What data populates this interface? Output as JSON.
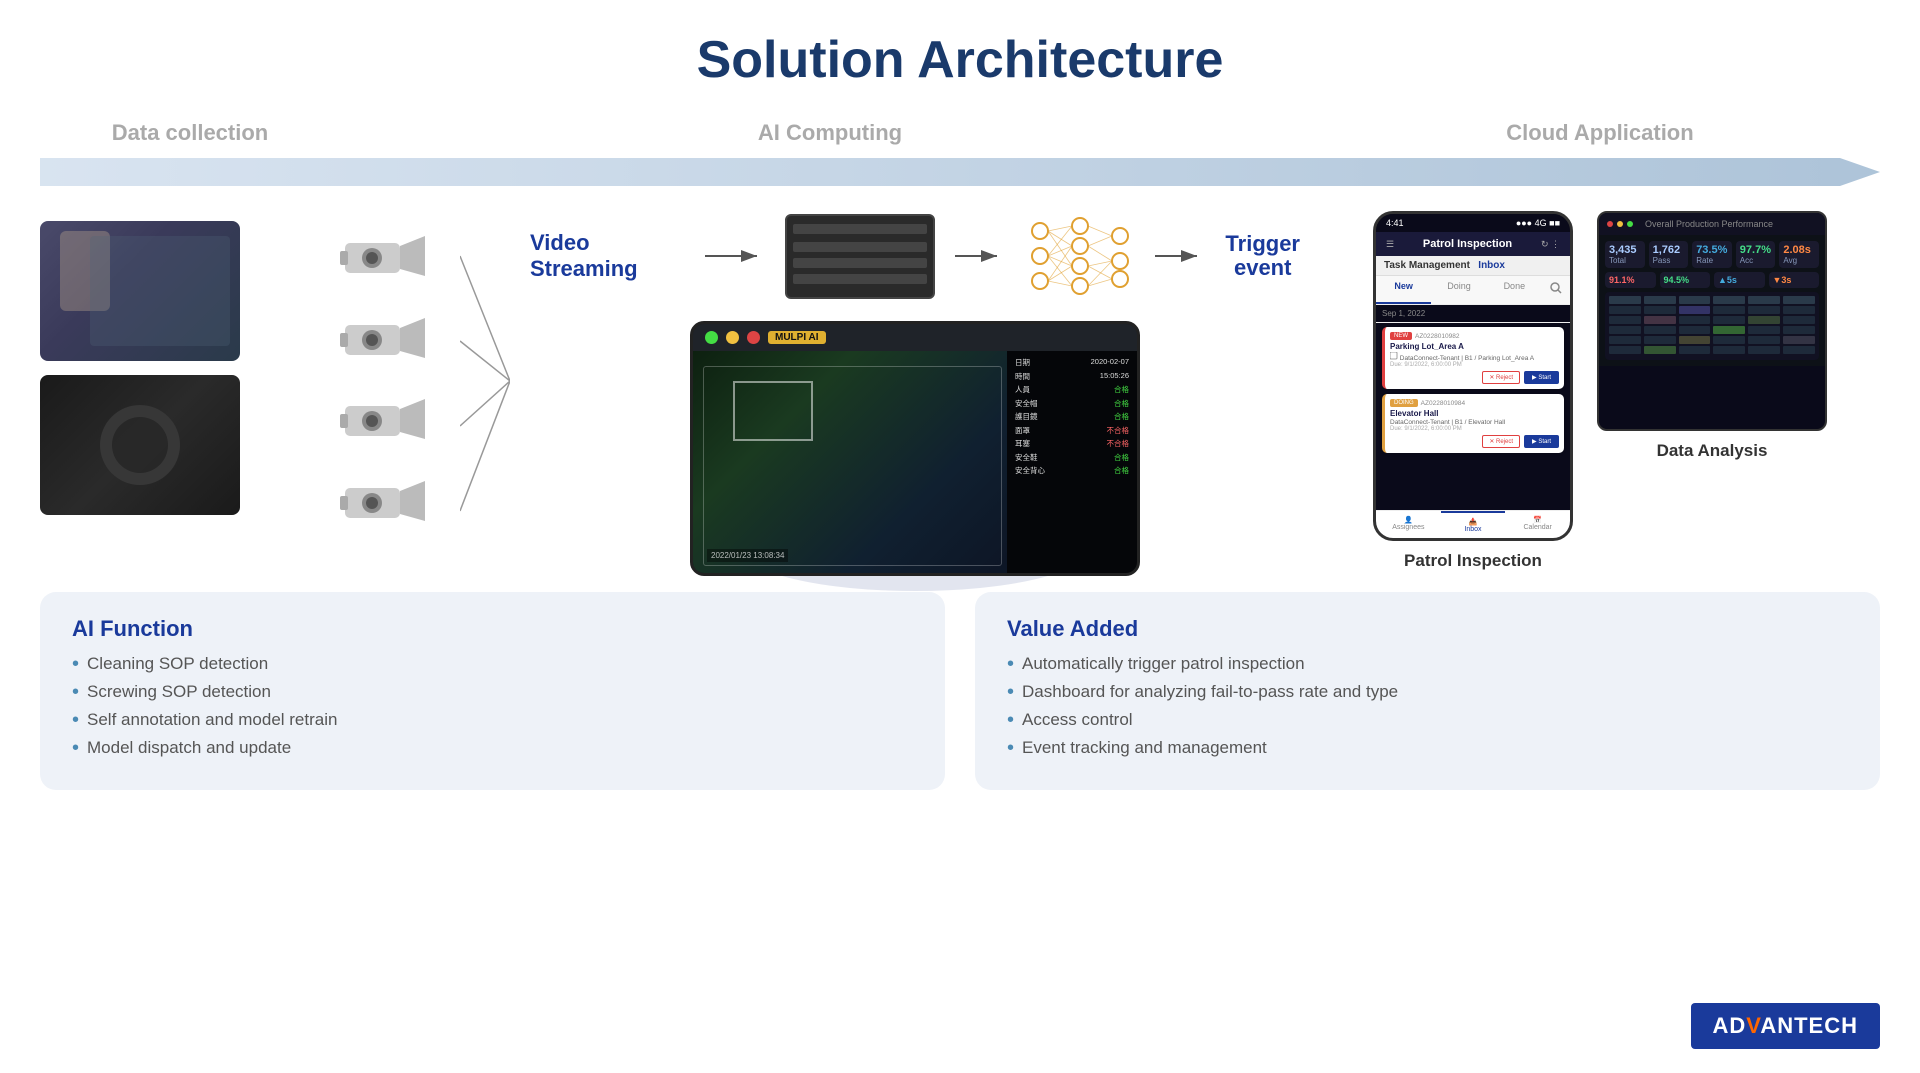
{
  "title": "Solution Architecture",
  "sections": {
    "data_collection": "Data collection",
    "ai_computing": "AI Computing",
    "cloud_application": "Cloud Application"
  },
  "labels": {
    "video_streaming": "Video Streaming",
    "trigger_event": "Trigger\nevent",
    "patrol_inspection": "Patrol Inspection",
    "data_analysis": "Data Analysis"
  },
  "ai_function": {
    "title": "AI Function",
    "items": [
      "Cleaning SOP detection",
      "Screwing SOP detection",
      "Self annotation and  model retrain",
      "Model dispatch and update"
    ]
  },
  "value_added": {
    "title": "Value Added",
    "items": [
      "Automatically trigger patrol inspection",
      "Dashboard for analyzing fail-to-pass rate and type",
      "Access control",
      "Event tracking and management"
    ]
  },
  "phone": {
    "title": "Patrol Inspection",
    "status_bar": "4:41",
    "tabs": [
      "New",
      "Doing",
      "Done"
    ],
    "inbox": "Inbox",
    "task1": {
      "id": "AZ0228010982",
      "name": "Parking Lot_Area A",
      "loc": "DataConnect-Tenant | B1 / Parking Lot_Area A",
      "due": "Due: 9/1/2022, 6:00:00 PM",
      "status": "red"
    },
    "task2": {
      "id": "AZ0228010984",
      "name": "Elevator Hall",
      "loc": "DataConnect-Tenant | B1 / Elevator Hall",
      "due": "Due: 9/1/2022, 6:00:00 PM",
      "status": "yellow"
    },
    "nav": [
      "Assignees",
      "Inbox",
      "Calendar"
    ]
  },
  "screen": {
    "timestamp": "2022/01/23  13:08:34",
    "badge": "MULPI AI",
    "info_rows": [
      {
        "label": "日期",
        "value": "2020-02-07"
      },
      {
        "label": "時間",
        "value": "15:05:26"
      },
      {
        "label": "人員",
        "value": "合格",
        "status": "green"
      },
      {
        "label": "安全帽",
        "value": "合格",
        "status": "green"
      },
      {
        "label": "護目鏡",
        "value": "合格",
        "status": "green"
      },
      {
        "label": "面罩",
        "value": "不合格",
        "status": "red"
      },
      {
        "label": "耳塞",
        "value": "不合格",
        "status": "red"
      },
      {
        "label": "安全鞋",
        "value": "合格",
        "status": "green"
      },
      {
        "label": "安全背心",
        "value": "合格",
        "status": "green"
      }
    ]
  },
  "advantech": {
    "brand": "AD",
    "brand2": "VANTECH"
  },
  "cameras": [
    {
      "id": "camera-1"
    },
    {
      "id": "camera-2"
    },
    {
      "id": "camera-3"
    },
    {
      "id": "camera-4"
    }
  ]
}
